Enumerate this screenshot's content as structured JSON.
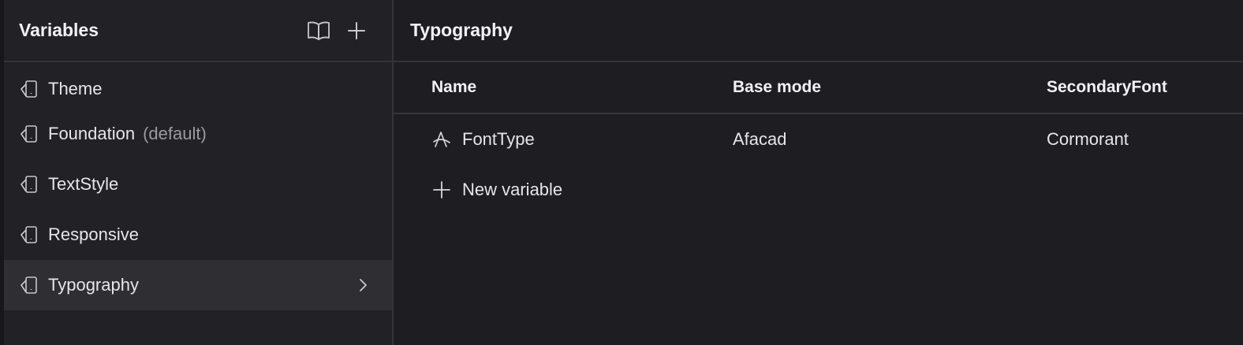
{
  "sidebar": {
    "title": "Variables",
    "header_icons": [
      "book-icon",
      "plus-icon"
    ],
    "collections": [
      {
        "label": "Theme",
        "tag": ""
      },
      {
        "label": "Foundation",
        "tag": "(default)"
      },
      {
        "label": "TextStyle",
        "tag": ""
      },
      {
        "label": "Responsive",
        "tag": ""
      },
      {
        "label": "Typography",
        "tag": "",
        "active": true
      }
    ]
  },
  "main": {
    "title": "Typography",
    "columns": [
      "Name",
      "Base mode",
      "SecondaryFont"
    ],
    "rows": [
      {
        "name": "FontType",
        "base": "Afacad",
        "secondary": "Cormorant",
        "icon": "font-icon"
      }
    ],
    "new_variable_label": "New variable"
  },
  "colors": {
    "background": "#1e1d21",
    "sidebar": "#222126",
    "active_item": "#2f2e33",
    "divider": "#35343a",
    "muted_text": "#9b9aa0"
  }
}
